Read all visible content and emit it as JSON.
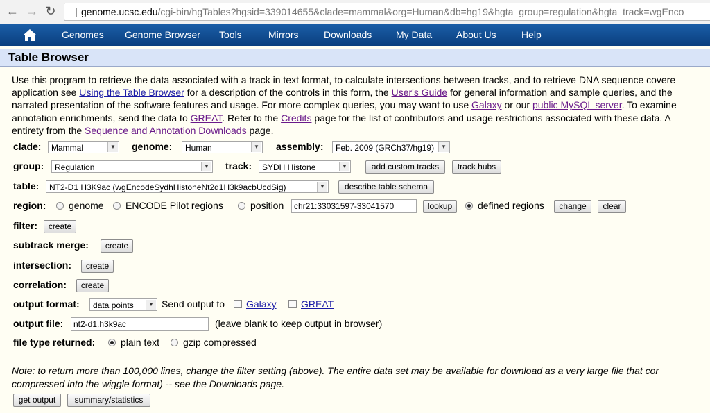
{
  "browser": {
    "back": "←",
    "forward": "→",
    "reload": "↻",
    "url_host": "genome.ucsc.edu",
    "url_rest": "/cgi-bin/hgTables?hgsid=339014655&clade=mammal&org=Human&db=hg19&hgta_group=regulation&hgta_track=wgEnco"
  },
  "menu": {
    "home_icon": "home-icon",
    "items": [
      "Genomes",
      "Genome Browser",
      "Tools",
      "Mirrors",
      "Downloads",
      "My Data",
      "About Us",
      "Help"
    ]
  },
  "page": {
    "title": "Table Browser"
  },
  "intro": {
    "line1": "Use this program to retrieve the data associated with a track in text format, to calculate intersections between tracks, and to retrieve DNA sequence covere",
    "line2_a": "application see ",
    "line2_link1": "Using the Table Browser",
    "line2_b": " for a description of the controls in this form, the ",
    "line2_link2": "User's Guide",
    "line2_c": " for general information and sample queries, and the",
    "line3_a": "narrated presentation of the software features and usage. For more complex queries, you may want to use ",
    "line3_link1": "Galaxy",
    "line3_b": " or our ",
    "line3_link2": "public MySQL server",
    "line3_c": ". To examine",
    "line4_a": "annotation enrichments, send the data to ",
    "line4_link1": "GREAT",
    "line4_b": ". Refer to the ",
    "line4_link2": "Credits",
    "line4_c": " page for the list of contributors and usage restrictions associated with these data. A",
    "line5_a": "entirety from the ",
    "line5_link1": "Sequence and Annotation Downloads",
    "line5_b": " page."
  },
  "form": {
    "clade_label": "clade:",
    "clade_value": "Mammal",
    "genome_label": "genome:",
    "genome_value": "Human",
    "assembly_label": "assembly:",
    "assembly_value": "Feb. 2009 (GRCh37/hg19)",
    "group_label": "group:",
    "group_value": "Regulation",
    "track_label": "track:",
    "track_value": "SYDH Histone",
    "add_custom_tracks": "add custom tracks",
    "track_hubs": "track hubs",
    "table_label": "table:",
    "table_value": "NT2-D1 H3K9ac (wgEncodeSydhHistoneNt2d1H3k9acbUcdSig)",
    "describe_schema": "describe table schema",
    "region_label": "region:",
    "region_genome": "genome",
    "region_encode": "ENCODE Pilot regions",
    "region_position": "position",
    "position_value": "chr21:33031597-33041570",
    "lookup": "lookup",
    "region_defined": "defined regions",
    "change": "change",
    "clear": "clear",
    "filter_label": "filter:",
    "create": "create",
    "subtrack_label": "subtrack merge:",
    "intersection_label": "intersection:",
    "correlation_label": "correlation:",
    "output_format_label": "output format:",
    "output_format_value": "data points",
    "send_output": "Send output to",
    "galaxy": "Galaxy",
    "great": "GREAT",
    "output_file_label": "output file:",
    "output_file_value": "nt2-d1.h3k9ac",
    "output_file_hint": "(leave blank to keep output in browser)",
    "file_type_label": "file type returned:",
    "plain_text": "plain text",
    "gzip": "gzip compressed"
  },
  "note": {
    "line1": "Note: to return more than 100,000 lines, change the filter setting (above). The entire data set may be available for download as a very large file that cor",
    "line2": "compressed into the wiggle format) -- see the Downloads page."
  },
  "actions": {
    "get_output": "get output",
    "summary": "summary/statistics"
  }
}
